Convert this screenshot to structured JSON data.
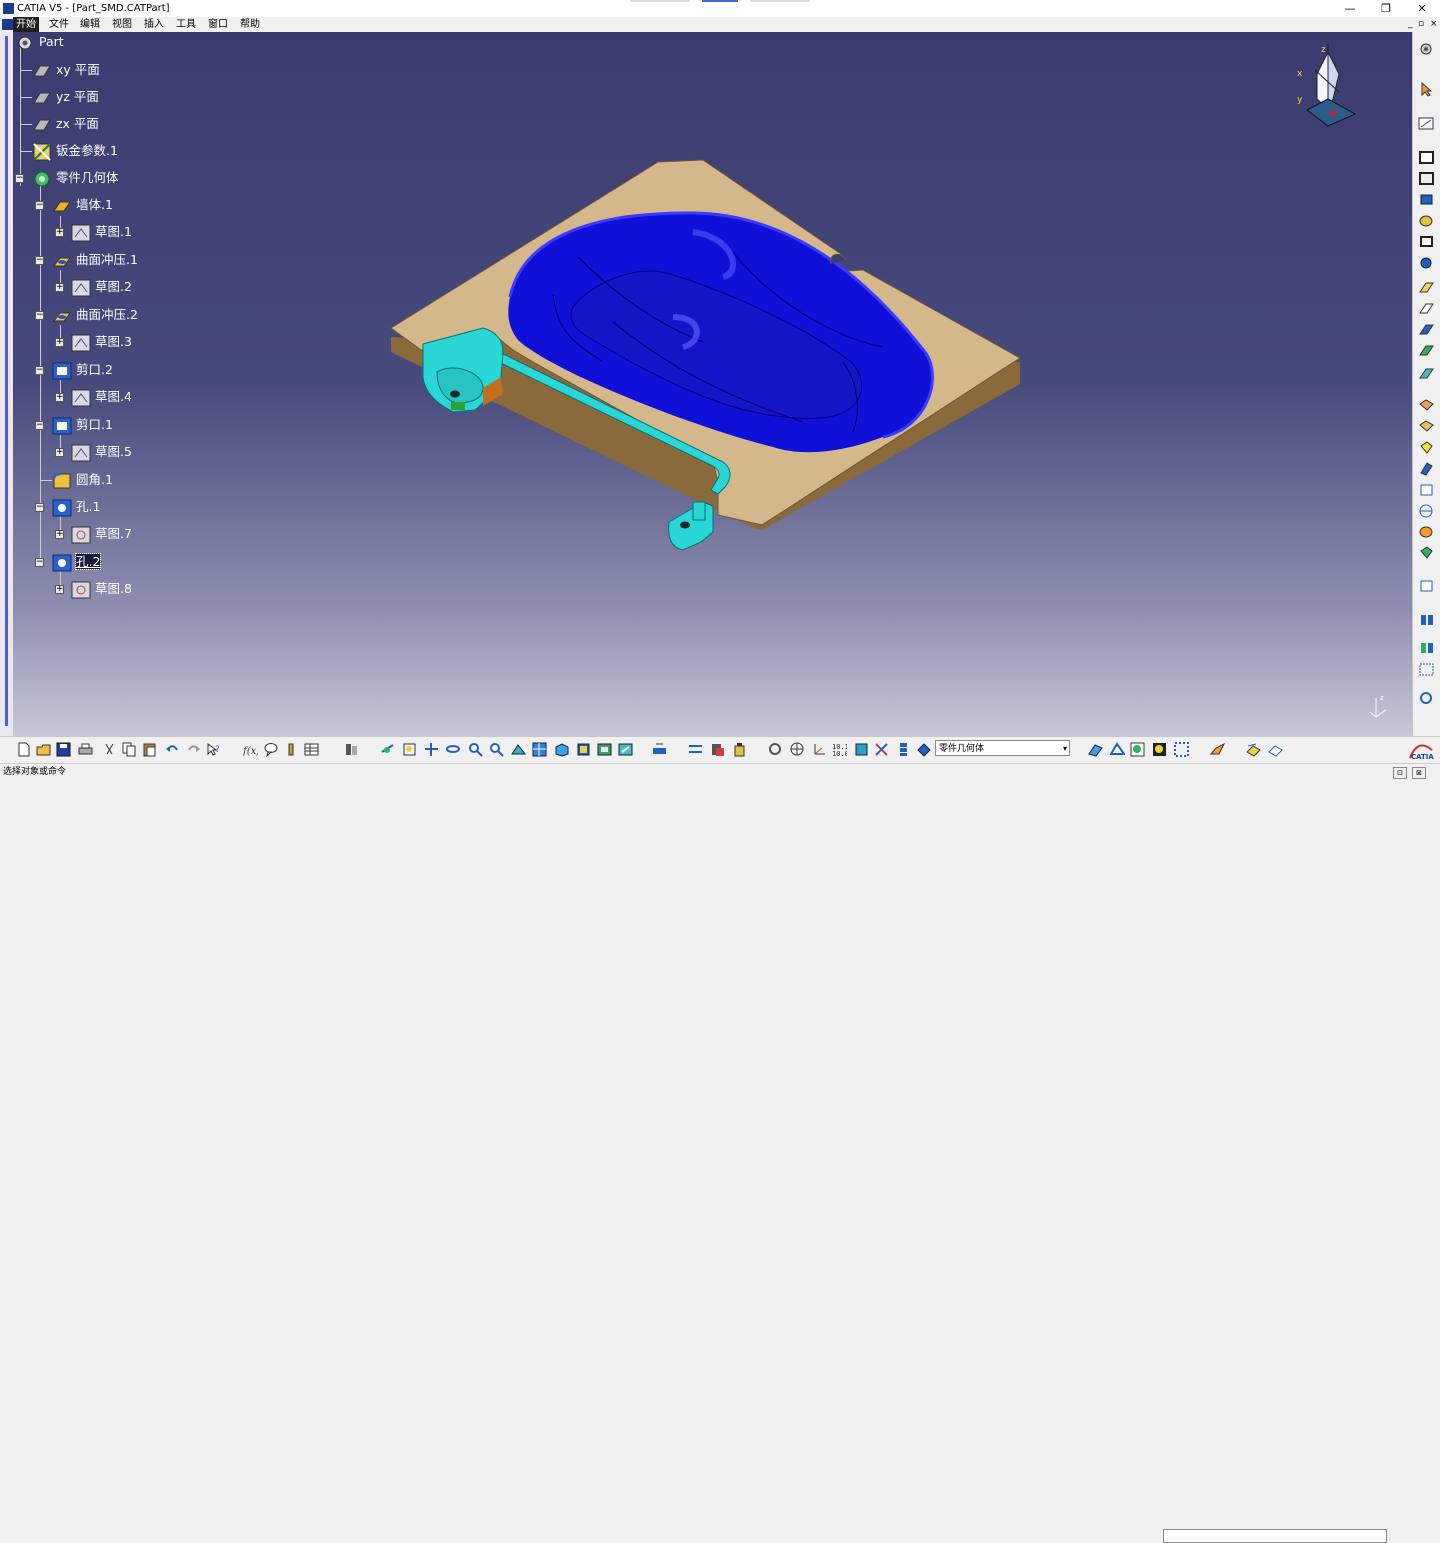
{
  "window": {
    "title": "CATIA V5 - [Part_SMD.CATPart]"
  },
  "menu": [
    "开始",
    "文件",
    "编辑",
    "视图",
    "插入",
    "工具",
    "窗口",
    "帮助"
  ],
  "tree": {
    "root": "Part",
    "items": [
      {
        "label": "xy 平面"
      },
      {
        "label": "yz 平面"
      },
      {
        "label": "zx 平面"
      },
      {
        "label": "钣金参数.1"
      },
      {
        "label": "零件几何体"
      },
      {
        "label": "墙体.1"
      },
      {
        "label": "草图.1"
      },
      {
        "label": "曲面冲压.1"
      },
      {
        "label": "草图.2"
      },
      {
        "label": "曲面冲压.2"
      },
      {
        "label": "草图.3"
      },
      {
        "label": "剪口.2"
      },
      {
        "label": "草图.4"
      },
      {
        "label": "剪口.1"
      },
      {
        "label": "草图.5"
      },
      {
        "label": "圆角.1"
      },
      {
        "label": "孔.1"
      },
      {
        "label": "草图.7"
      },
      {
        "label": "孔.2"
      },
      {
        "label": "草图.8"
      }
    ]
  },
  "compass": {
    "x": "x",
    "y": "y",
    "z": "z"
  },
  "body_selector": {
    "value": "零件几何体"
  },
  "status": {
    "message": "选择对象或命令"
  },
  "icons": {
    "toolbar": [
      "new-icon",
      "open-icon",
      "save-icon",
      "print-icon",
      "cut-icon",
      "copy-icon",
      "paste-icon",
      "undo-icon",
      "redo-icon",
      "whats-this-icon",
      "formula-icon",
      "comment-icon",
      "knowledge-icon",
      "table-icon",
      "catalog-icon",
      "fly-icon",
      "fit-all-icon",
      "pan-icon",
      "rotate-icon",
      "zoom-in-icon",
      "zoom-out-icon",
      "normal-view-icon",
      "multi-view-icon",
      "iso-view-icon",
      "shading-icon",
      "hide-show-icon",
      "swap-space-icon",
      "measure-icon",
      "inertia-icon",
      "bottle-icon",
      "update-icon",
      "axis-system-icon",
      "3d-axis-icon",
      "numeric-icon",
      "snap-icon",
      "body-icon",
      "scan-icon",
      "sheetmetal-parameters-icon",
      "wall-icon",
      "flange-icon",
      "bend-icon",
      "unfold-icon",
      "rule-icon",
      "analysis-icon",
      "catia-logo"
    ]
  }
}
